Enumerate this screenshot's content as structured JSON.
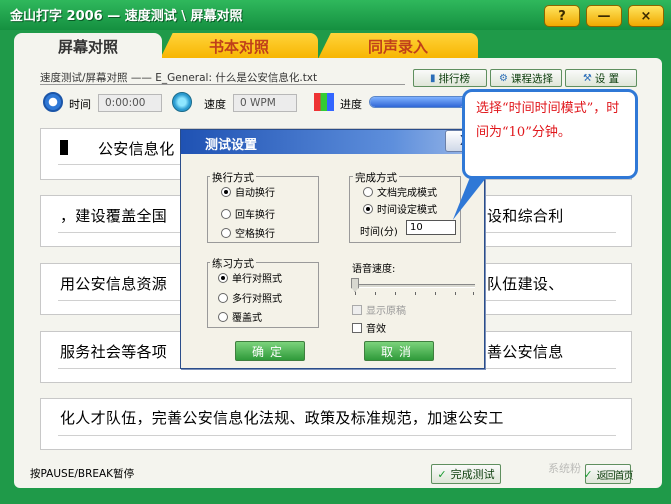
{
  "window": {
    "title": "金山打字 2006 — 速度测试 \\ 屏幕对照",
    "help_label": "?",
    "minimize_label": "—",
    "close_label": "×"
  },
  "tabs": [
    {
      "label": "屏幕对照"
    },
    {
      "label": "书本对照"
    },
    {
      "label": "同声录入"
    }
  ],
  "header": {
    "file_info": "速度测试/屏幕对照 —— E_General: 什么是公安信息化.txt",
    "ranking_label": "排行榜",
    "course_label": "课程选择",
    "settings_label": "设 置"
  },
  "status": {
    "time_label": "时间",
    "time_value": "0:00:00",
    "speed_label": "速度",
    "speed_value": "0 WPM",
    "progress_label": "进度",
    "progress_fraction": 0.95
  },
  "rows": [
    "公安信息化",
    "，建设覆盖全国",
    "用公安信息资源",
    "服务社会等各项",
    "化人才队伍，完善公安信息化法规、政策及标准规范，加速公安工"
  ],
  "rows_right": [
    "",
    "设和综合利",
    "队伍建设、",
    "善公安信息",
    ""
  ],
  "footer": {
    "pause_hint": "按PAUSE/BREAK暂停",
    "finish_label": "完成测试",
    "back_label": "返回首页",
    "watermark": "系统粉"
  },
  "dialog": {
    "title": "测试设置",
    "close_label": "X",
    "line_mode": {
      "title": "换行方式",
      "options": [
        {
          "label": "自动换行",
          "selected": true
        },
        {
          "label": "回车换行",
          "selected": false
        },
        {
          "label": "空格换行",
          "selected": false
        }
      ]
    },
    "finish_mode": {
      "title": "完成方式",
      "options": [
        {
          "label": "文档完成模式",
          "selected": false
        },
        {
          "label": "时间设定模式",
          "selected": true
        }
      ],
      "time_label": "时间(分)",
      "time_value": "10"
    },
    "practice_mode": {
      "title": "练习方式",
      "options": [
        {
          "label": "单行对照式",
          "selected": true
        },
        {
          "label": "多行对照式",
          "selected": false
        },
        {
          "label": "覆盖式",
          "selected": false
        }
      ]
    },
    "voice": {
      "speed_label": "语音速度:",
      "show_source_label": "显示原稿",
      "sound_label": "音效"
    },
    "ok_label": "确定",
    "cancel_label": "取消"
  },
  "callout": {
    "text": "选择“时间时间模式”，时间为“10”分钟。"
  },
  "colors": {
    "frame_green": "#1f9a49",
    "tab_yellow": "#f7b400",
    "dialog_title_blue": "#1f52b3",
    "callout_border": "#2f78d6",
    "callout_text": "#e0161b"
  }
}
